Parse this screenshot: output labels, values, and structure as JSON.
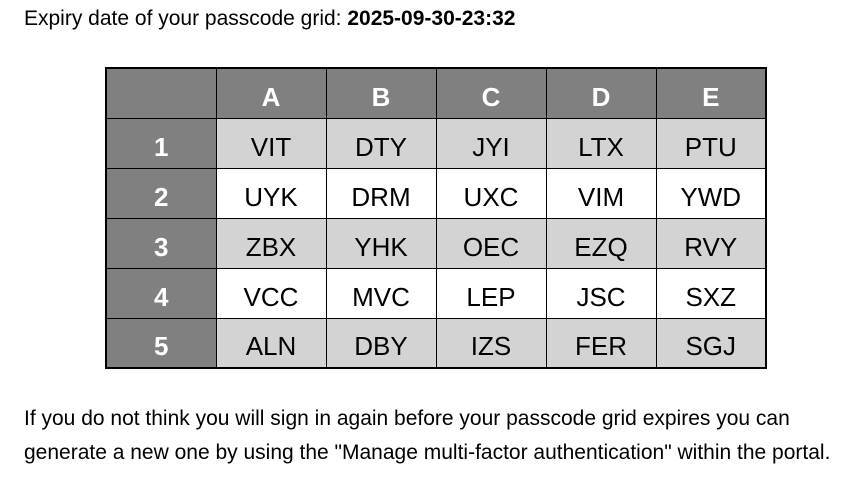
{
  "expiry": {
    "label": "Expiry date of your passcode grid: ",
    "date": "2025-09-30-23:32"
  },
  "grid": {
    "columns": [
      "A",
      "B",
      "C",
      "D",
      "E"
    ],
    "rows": [
      {
        "label": "1",
        "cells": [
          "VIT",
          "DTY",
          "JYI",
          "LTX",
          "PTU"
        ]
      },
      {
        "label": "2",
        "cells": [
          "UYK",
          "DRM",
          "UXC",
          "VIM",
          "YWD"
        ]
      },
      {
        "label": "3",
        "cells": [
          "ZBX",
          "YHK",
          "OEC",
          "EZQ",
          "RVY"
        ]
      },
      {
        "label": "4",
        "cells": [
          "VCC",
          "MVC",
          "LEP",
          "JSC",
          "SXZ"
        ]
      },
      {
        "label": "5",
        "cells": [
          "ALN",
          "DBY",
          "IZS",
          "FER",
          "SGJ"
        ]
      }
    ],
    "colors": {
      "header_bg": "#808080",
      "header_text": "#ffffff",
      "shaded_row_bg": "#d3d3d3",
      "plain_row_bg": "#ffffff"
    }
  },
  "note": {
    "text": "If you do not think you will sign in again before your passcode grid expires you can generate a new one by using the \"Manage multi-factor authentication\" within the portal."
  }
}
